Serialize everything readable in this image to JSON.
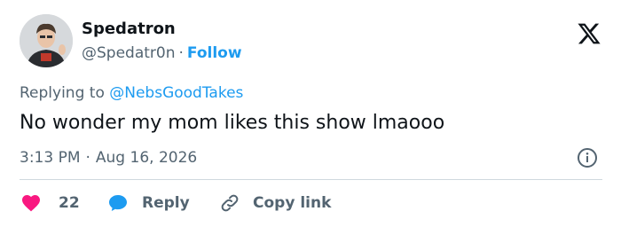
{
  "author": {
    "name": "Spedatron",
    "handle": "@Spedatr0n",
    "follow_label": "Follow",
    "avatar_icon": "avatar"
  },
  "platform_icon": "x-logo-icon",
  "reply": {
    "prefix": "Replying to",
    "mention": "@NebsGoodTakes"
  },
  "tweet": {
    "text": "No wonder my mom likes this show lmaooo"
  },
  "meta": {
    "time": "3:13 PM",
    "date": "Aug 16, 2026"
  },
  "actions": {
    "like_count": "22",
    "reply_label": "Reply",
    "copy_link_label": "Copy link"
  },
  "colors": {
    "accent": "#1d9bf0",
    "like": "#f91880",
    "text": "#0f1419",
    "secondary": "#536471",
    "divider": "#cfd9de"
  }
}
